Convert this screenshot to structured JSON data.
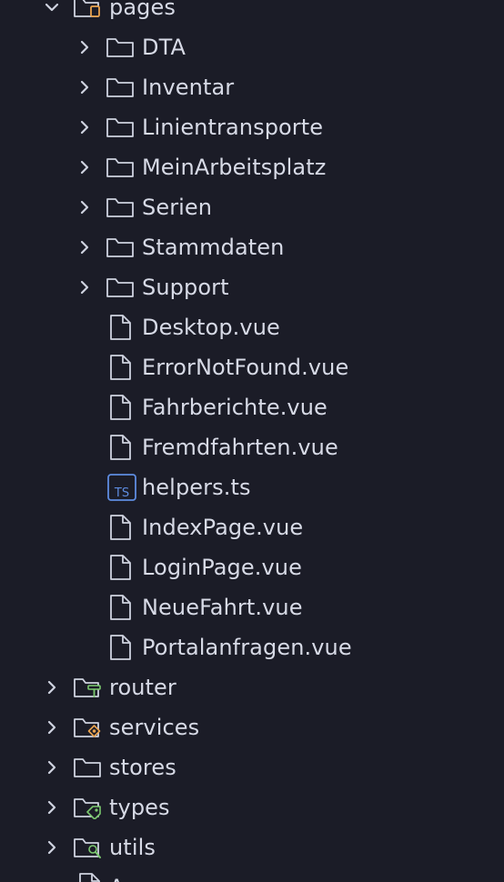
{
  "explorer": {
    "colors": {
      "background": "#1b1c27",
      "text": "#d7dae6",
      "icon_stroke": "#cfd3e0",
      "accent_orange": "#e9a24e",
      "accent_green": "#7bc96f",
      "accent_blue": "#5e8ce0"
    },
    "items": [
      {
        "label": "pages",
        "type": "folder-open",
        "depth": 0,
        "icon": "folder-open-icon"
      },
      {
        "label": "DTA",
        "type": "folder",
        "depth": 1,
        "icon": "folder-icon"
      },
      {
        "label": "Inventar",
        "type": "folder",
        "depth": 1,
        "icon": "folder-icon"
      },
      {
        "label": "Linientransporte",
        "type": "folder",
        "depth": 1,
        "icon": "folder-icon"
      },
      {
        "label": "MeinArbeitsplatz",
        "type": "folder",
        "depth": 1,
        "icon": "folder-icon"
      },
      {
        "label": "Serien",
        "type": "folder",
        "depth": 1,
        "icon": "folder-icon"
      },
      {
        "label": "Stammdaten",
        "type": "folder",
        "depth": 1,
        "icon": "folder-icon"
      },
      {
        "label": "Support",
        "type": "folder",
        "depth": 1,
        "icon": "folder-icon"
      },
      {
        "label": "Desktop.vue",
        "type": "file",
        "depth": 1,
        "icon": "file-icon"
      },
      {
        "label": "ErrorNotFound.vue",
        "type": "file",
        "depth": 1,
        "icon": "file-icon"
      },
      {
        "label": "Fahrberichte.vue",
        "type": "file",
        "depth": 1,
        "icon": "file-icon"
      },
      {
        "label": "Fremdfahrten.vue",
        "type": "file",
        "depth": 1,
        "icon": "file-icon"
      },
      {
        "label": "helpers.ts",
        "type": "ts-file",
        "depth": 1,
        "icon": "typescript-file-icon",
        "badge": "TS"
      },
      {
        "label": "IndexPage.vue",
        "type": "file",
        "depth": 1,
        "icon": "file-icon"
      },
      {
        "label": "LoginPage.vue",
        "type": "file",
        "depth": 1,
        "icon": "file-icon"
      },
      {
        "label": "NeueFahrt.vue",
        "type": "file",
        "depth": 1,
        "icon": "file-icon"
      },
      {
        "label": "Portalanfragen.vue",
        "type": "file",
        "depth": 1,
        "icon": "file-icon"
      },
      {
        "label": "router",
        "type": "folder",
        "depth": 0,
        "icon": "router-folder-icon"
      },
      {
        "label": "services",
        "type": "folder",
        "depth": 0,
        "icon": "services-folder-icon"
      },
      {
        "label": "stores",
        "type": "folder",
        "depth": 0,
        "icon": "folder-icon"
      },
      {
        "label": "types",
        "type": "folder",
        "depth": 0,
        "icon": "types-folder-icon"
      },
      {
        "label": "utils",
        "type": "folder",
        "depth": 0,
        "icon": "utils-folder-icon"
      },
      {
        "label": "A",
        "type": "file",
        "depth": 0,
        "icon": "file-icon"
      }
    ]
  }
}
